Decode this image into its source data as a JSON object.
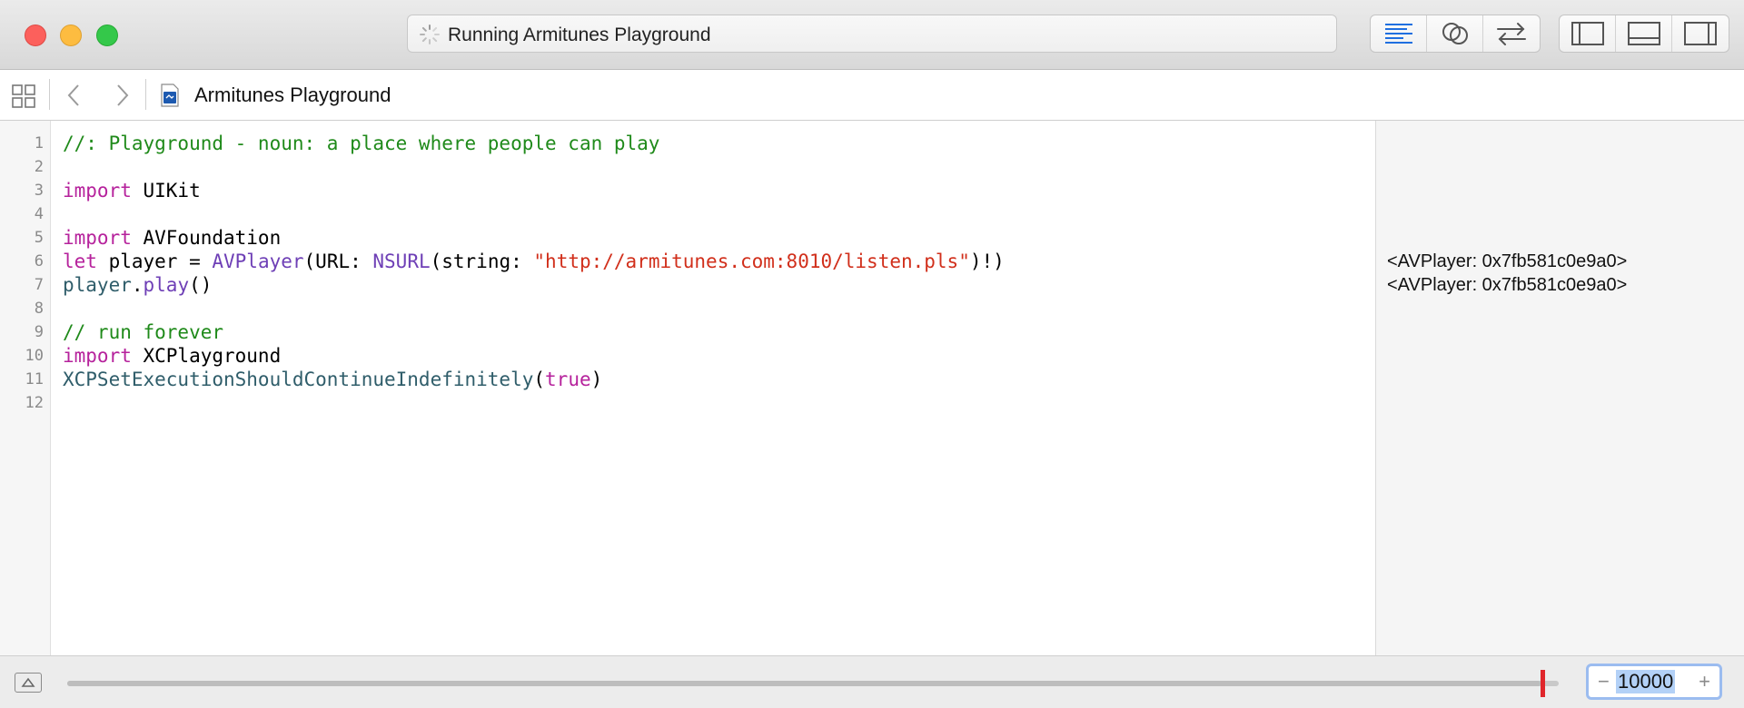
{
  "window": {
    "activity_text": "Running Armitunes Playground",
    "toolbar": {
      "editors": [
        "standard-editor-icon",
        "assistant-editor-icon",
        "version-editor-icon"
      ],
      "panels": [
        "navigator-panel-icon",
        "debug-panel-icon",
        "utilities-panel-icon"
      ]
    }
  },
  "jumpbar": {
    "file_title": "Armitunes Playground"
  },
  "editor": {
    "line_numbers": [
      "1",
      "2",
      "3",
      "4",
      "5",
      "6",
      "7",
      "8",
      "9",
      "10",
      "11",
      "12"
    ],
    "lines": [
      [
        {
          "t": "//: Playground - noun: a place where people can play",
          "c": "cm"
        }
      ],
      [],
      [
        {
          "t": "import",
          "c": "kw"
        },
        {
          "t": " UIKit",
          "c": "pl"
        }
      ],
      [],
      [
        {
          "t": "import",
          "c": "kw"
        },
        {
          "t": " AVFoundation",
          "c": "pl"
        }
      ],
      [
        {
          "t": "let",
          "c": "kw"
        },
        {
          "t": " player = ",
          "c": "pl"
        },
        {
          "t": "AVPlayer",
          "c": "ty"
        },
        {
          "t": "(URL: ",
          "c": "pl"
        },
        {
          "t": "NSURL",
          "c": "ty"
        },
        {
          "t": "(string: ",
          "c": "pl"
        },
        {
          "t": "\"http://armitunes.com:8010/listen.pls\"",
          "c": "st"
        },
        {
          "t": ")!)",
          "c": "pl"
        }
      ],
      [
        {
          "t": "player",
          "c": "id"
        },
        {
          "t": ".",
          "c": "pl"
        },
        {
          "t": "play",
          "c": "ty"
        },
        {
          "t": "()",
          "c": "pl"
        }
      ],
      [],
      [
        {
          "t": "// run forever",
          "c": "cm"
        }
      ],
      [
        {
          "t": "import",
          "c": "kw"
        },
        {
          "t": " XCPlayground",
          "c": "pl"
        }
      ],
      [
        {
          "t": "XCPSetExecutionShouldContinueIndefinitely",
          "c": "id"
        },
        {
          "t": "(",
          "c": "pl"
        },
        {
          "t": "true",
          "c": "kw"
        },
        {
          "t": ")",
          "c": "pl"
        }
      ],
      []
    ]
  },
  "results": [
    {
      "line": 6,
      "text": "<AVPlayer: 0x7fb581c0e9a0>"
    },
    {
      "line": 7,
      "text": "<AVPlayer: 0x7fb581c0e9a0>"
    }
  ],
  "bottombar": {
    "timeline_value": 10000,
    "stepper_minus": "−",
    "stepper_plus": "+",
    "stepper_value": "10000"
  },
  "colors": {
    "keyword": "#b6229c",
    "comment": "#1f8a1a",
    "type": "#6e3fb6",
    "string": "#d12f1b",
    "identifier": "#2f5d6a",
    "timeline_marker": "#e0262b"
  }
}
